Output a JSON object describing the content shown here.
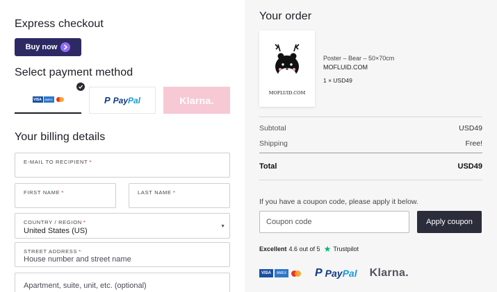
{
  "left": {
    "express_title": "Express checkout",
    "buy_now_label": "Buy now",
    "payment_title": "Select payment method",
    "payment_methods": [
      {
        "name": "cards",
        "selected": true
      },
      {
        "name": "PayPal",
        "label_a": "Pay",
        "label_b": "Pal"
      },
      {
        "name": "Klarna",
        "label": "Klarna."
      }
    ],
    "billing_title": "Your billing details",
    "fields": {
      "email": {
        "label": "E-MAIL TO RECIPIENT",
        "required": "*"
      },
      "first_name": {
        "label": "FIRST NAME",
        "required": "*"
      },
      "last_name": {
        "label": "LAST NAME",
        "required": "*"
      },
      "country": {
        "label": "COUNTRY / REGION",
        "required": "*",
        "value": "United States (US)"
      },
      "street": {
        "label": "STREET ADDRESS",
        "required": "*",
        "placeholder": "House number and street name"
      },
      "apartment": {
        "placeholder": "Apartment, suite, unit, etc. (optional)"
      }
    }
  },
  "right": {
    "order_title": "Your order",
    "product": {
      "name": "Poster – Bear – 50×70cm",
      "brand": "MOFLUID.COM",
      "qty_price": "1 × USD49",
      "image_caption": "MOFLUID.COM"
    },
    "summary": {
      "subtotal_label": "Subtotal",
      "subtotal_value": "USD49",
      "shipping_label": "Shipping",
      "shipping_value": "Free!",
      "total_label": "Total",
      "total_value": "USD49"
    },
    "coupon": {
      "note": "If you have a coupon code, please apply it below.",
      "placeholder": "Coupon code",
      "button": "Apply coupon"
    },
    "trustpilot": {
      "rating_word": "Excellent",
      "score_text": "4.6 out of 5",
      "brand": "Trustpilot"
    },
    "footer_logos": {
      "paypal_a": "Pay",
      "paypal_b": "Pal",
      "klarna": "Klarna."
    }
  },
  "colors": {
    "buy_now_bg": "#2d2a63",
    "buy_now_icon": "#8f6cf4",
    "klarna_pink": "#f7c9d4",
    "apply_button_bg": "#2b2e3a",
    "trustpilot_green": "#00b67a",
    "required_red": "#d6183a"
  },
  "icons": [
    "checkmark-icon",
    "chevron-right-icon",
    "visa-icon",
    "amex-icon",
    "mastercard-icon",
    "paypal-icon",
    "klarna-logo",
    "star-icon",
    "dropdown-caret-icon"
  ]
}
